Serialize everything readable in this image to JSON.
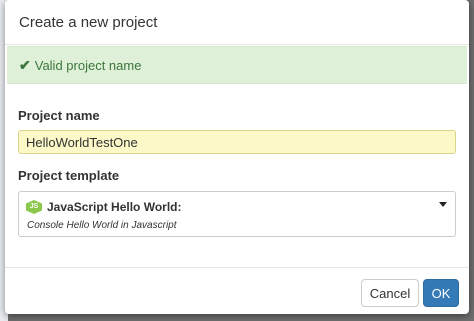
{
  "modal": {
    "title": "Create a new project"
  },
  "alert": {
    "icon": "checkmark-icon",
    "message": "Valid project name",
    "color": "#3c763d",
    "background": "#dff0d8"
  },
  "form": {
    "project_name_label": "Project name",
    "project_name_value": "HelloWorldTestOne",
    "project_template_label": "Project template",
    "template": {
      "icon": "nodejs-icon",
      "icon_text": "JS",
      "name": "JavaScript Hello World:",
      "description": "Console Hello World in Javascript"
    }
  },
  "footer": {
    "cancel_label": "Cancel",
    "ok_label": "OK",
    "ok_color": "#337ab7"
  }
}
